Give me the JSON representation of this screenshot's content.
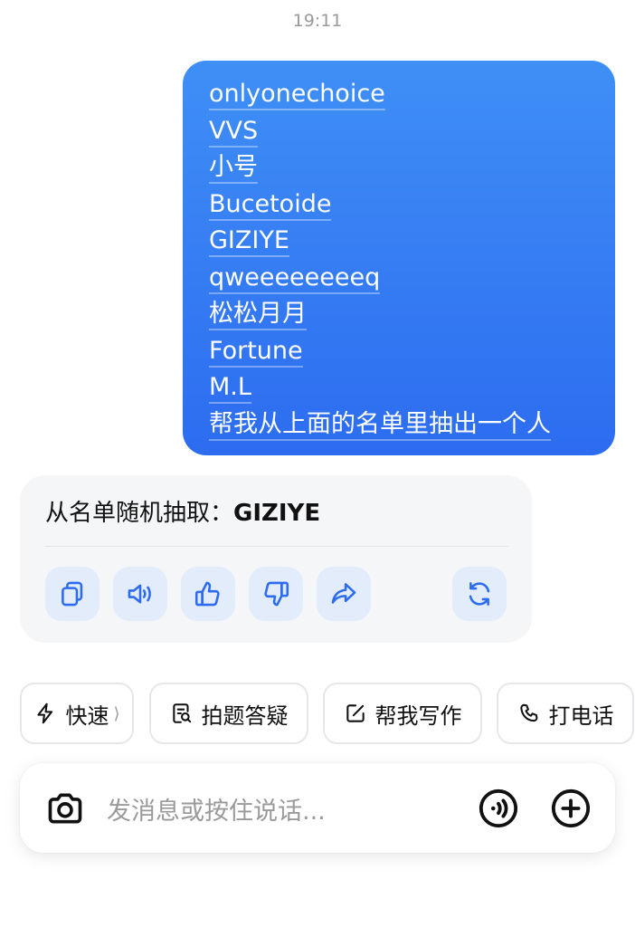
{
  "status": {
    "time": "19:11"
  },
  "user_message": {
    "lines": [
      "onlyonechoice",
      "VVS",
      "小号",
      "Bucetoide",
      "GIZIYE",
      "qweeeeeeeeq",
      "松松月月",
      "Fortune",
      "M.L",
      "帮我从上面的名单里抽出一个人"
    ]
  },
  "assistant_message": {
    "prefix": "从名单随机抽取：",
    "result": "GIZIYE",
    "actions": [
      {
        "icon": "copy-icon"
      },
      {
        "icon": "speaker-icon"
      },
      {
        "icon": "thumbs-up-icon"
      },
      {
        "icon": "thumbs-down-icon"
      },
      {
        "icon": "share-icon"
      },
      {
        "icon": "regenerate-icon"
      }
    ]
  },
  "quick_actions": [
    {
      "label": "快速",
      "icon": "lightning-icon",
      "chevron": "⟩"
    },
    {
      "label": "拍题答疑",
      "icon": "scan-question-icon"
    },
    {
      "label": "帮我写作",
      "icon": "edit-icon"
    },
    {
      "label": "打电话",
      "icon": "phone-icon"
    }
  ],
  "input": {
    "placeholder": "发消息或按住说话...",
    "left_icon": "camera-icon",
    "right_icons": [
      "voice-call-icon",
      "add-icon"
    ]
  },
  "colors": {
    "bubble_gradient_top": "#3f8ff6",
    "bubble_gradient_bottom": "#2d6cf0",
    "accent": "#2d6cf0",
    "action_bg": "#e3ecfb",
    "assistant_bg": "#f5f6f8"
  }
}
